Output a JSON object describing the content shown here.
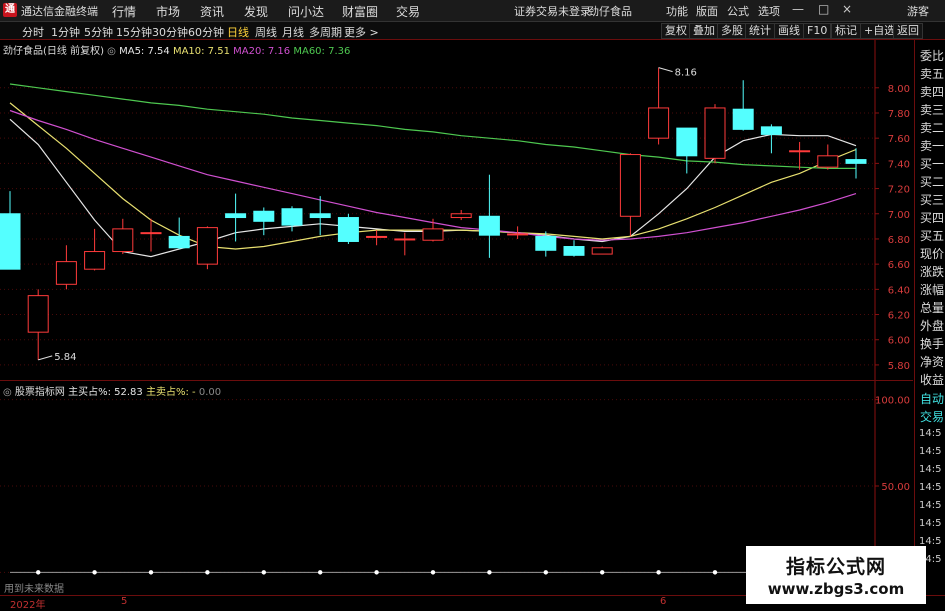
{
  "app": {
    "title": "通达信金融终端",
    "logo_text": "通"
  },
  "menu": [
    "行情",
    "市场",
    "资讯",
    "发现",
    "问小达",
    "财富圈",
    "交易"
  ],
  "notice": {
    "login": "证券交易未登录",
    "stock": "劲仔食品"
  },
  "right_menu": [
    "功能",
    "版面",
    "公式",
    "选项"
  ],
  "guest": "游客",
  "window_controls": {
    "minimize": "—",
    "maximize": "□",
    "close": "×"
  },
  "periods": [
    "分时",
    "1分钟",
    "5分钟",
    "15分钟",
    "30分钟",
    "60分钟",
    "日线",
    "周线",
    "月线",
    "多周期",
    "更多 >"
  ],
  "active_period": "日线",
  "toolbar": [
    "复权",
    "叠加",
    "多股",
    "统计",
    "画线",
    "F10",
    "标记",
    "+自选",
    "返回"
  ],
  "main_legend": {
    "stock": "劲仔食品(日线 前复权)",
    "ma5": "MA5: 7.54",
    "ma10": "MA10: 7.51",
    "ma20": "MA20: 7.16",
    "ma60": "MA60: 7.36"
  },
  "sub_legend": {
    "name": "股票指标网",
    "buy": "主买占%: 52.83",
    "sell_label": "主卖占%: -",
    "sell_value": "0.00"
  },
  "right_panel": [
    "委比",
    "卖五",
    "卖四",
    "卖三",
    "卖二",
    "卖一",
    "买一",
    "买二",
    "买三",
    "买四",
    "买五",
    "现价",
    "涨跌",
    "涨幅",
    "总量",
    "外盘",
    "换手",
    "净资",
    "收益",
    "自动",
    "交易"
  ],
  "tick_times": [
    "14:5",
    "14:5",
    "14:5",
    "14:5",
    "14:5",
    "14:5",
    "14:5",
    "14:5"
  ],
  "bottom_dates": [
    "2022年",
    "5",
    "6"
  ],
  "bottom_hint": "用到未来数据",
  "watermark": {
    "line1": "指标公式网",
    "line2": "www.zbgs3.com"
  },
  "colors": {
    "up": "#ff3b3b",
    "down": "#54ffff",
    "ma5": "#e6e6e6",
    "ma10": "#e8e070",
    "ma20": "#d050d0",
    "ma60": "#4ec850",
    "grid": "#4a0a0a",
    "axis": "#8b1010"
  },
  "chart_data": [
    {
      "type": "candlestick",
      "title": "劲仔食品(日线 前复权)",
      "y_ticks": [
        5.8,
        6.0,
        6.2,
        6.4,
        6.6,
        6.8,
        7.0,
        7.2,
        7.4,
        7.6,
        7.8,
        8.0
      ],
      "ylim": [
        5.72,
        8.3
      ],
      "annotations": [
        {
          "label": "8.16",
          "value": 8.16,
          "index": 23
        },
        {
          "label": "5.84",
          "value": 5.84,
          "index": 1
        }
      ],
      "candles": [
        {
          "o": 7.0,
          "c": 6.56,
          "h": 7.18,
          "l": 6.56
        },
        {
          "o": 6.06,
          "c": 6.35,
          "h": 6.4,
          "l": 5.84
        },
        {
          "o": 6.44,
          "c": 6.62,
          "h": 6.75,
          "l": 6.4
        },
        {
          "o": 6.56,
          "c": 6.7,
          "h": 6.88,
          "l": 6.55
        },
        {
          "o": 6.7,
          "c": 6.88,
          "h": 6.96,
          "l": 6.68
        },
        {
          "o": 6.85,
          "c": 6.85,
          "h": 6.96,
          "l": 6.7
        },
        {
          "o": 6.82,
          "c": 6.73,
          "h": 6.97,
          "l": 6.72
        },
        {
          "o": 6.6,
          "c": 6.89,
          "h": 6.9,
          "l": 6.56
        },
        {
          "o": 7.0,
          "c": 6.97,
          "h": 7.16,
          "l": 6.78
        },
        {
          "o": 7.02,
          "c": 6.94,
          "h": 7.05,
          "l": 6.83
        },
        {
          "o": 7.04,
          "c": 6.91,
          "h": 7.06,
          "l": 6.86
        },
        {
          "o": 7.0,
          "c": 6.97,
          "h": 7.14,
          "l": 6.83
        },
        {
          "o": 6.97,
          "c": 6.78,
          "h": 7.0,
          "l": 6.76
        },
        {
          "o": 6.82,
          "c": 6.82,
          "h": 6.87,
          "l": 6.75
        },
        {
          "o": 6.8,
          "c": 6.8,
          "h": 6.85,
          "l": 6.67
        },
        {
          "o": 6.79,
          "c": 6.88,
          "h": 6.96,
          "l": 6.78
        },
        {
          "o": 6.97,
          "c": 7.0,
          "h": 7.03,
          "l": 6.95
        },
        {
          "o": 6.98,
          "c": 6.83,
          "h": 7.31,
          "l": 6.65
        },
        {
          "o": 6.84,
          "c": 6.84,
          "h": 6.9,
          "l": 6.8
        },
        {
          "o": 6.82,
          "c": 6.71,
          "h": 6.86,
          "l": 6.66
        },
        {
          "o": 6.74,
          "c": 6.67,
          "h": 6.79,
          "l": 6.66
        },
        {
          "o": 6.68,
          "c": 6.73,
          "h": 6.74,
          "l": 6.68
        },
        {
          "o": 6.98,
          "c": 7.47,
          "h": 7.48,
          "l": 6.82
        },
        {
          "o": 7.6,
          "c": 7.84,
          "h": 8.16,
          "l": 7.55
        },
        {
          "o": 7.68,
          "c": 7.46,
          "h": 7.68,
          "l": 7.32
        },
        {
          "o": 7.44,
          "c": 7.84,
          "h": 7.87,
          "l": 7.4
        },
        {
          "o": 7.83,
          "c": 7.67,
          "h": 8.06,
          "l": 7.66
        },
        {
          "o": 7.69,
          "c": 7.63,
          "h": 7.71,
          "l": 7.48
        },
        {
          "o": 7.5,
          "c": 7.5,
          "h": 7.57,
          "l": 7.35
        },
        {
          "o": 7.37,
          "c": 7.46,
          "h": 7.55,
          "l": 7.35
        },
        {
          "o": 7.43,
          "c": 7.4,
          "h": 7.52,
          "l": 7.28
        }
      ],
      "series": [
        {
          "name": "MA5",
          "values": [
            7.75,
            7.55,
            7.25,
            6.95,
            6.7,
            6.66,
            6.72,
            6.78,
            6.85,
            6.88,
            6.9,
            6.92,
            6.9,
            6.88,
            6.86,
            6.86,
            6.87,
            6.86,
            6.85,
            6.83,
            6.8,
            6.78,
            6.82,
            7.0,
            7.2,
            7.45,
            7.58,
            7.63,
            7.62,
            7.62,
            7.54
          ]
        },
        {
          "name": "MA10",
          "values": [
            7.88,
            7.7,
            7.52,
            7.32,
            7.12,
            6.95,
            6.83,
            6.74,
            6.72,
            6.74,
            6.78,
            6.82,
            6.85,
            6.87,
            6.87,
            6.87,
            6.87,
            6.86,
            6.85,
            6.84,
            6.82,
            6.8,
            6.82,
            6.88,
            6.96,
            7.05,
            7.15,
            7.25,
            7.32,
            7.42,
            7.51
          ]
        },
        {
          "name": "MA20",
          "values": [
            7.82,
            7.74,
            7.67,
            7.59,
            7.52,
            7.45,
            7.38,
            7.31,
            7.26,
            7.21,
            7.16,
            7.11,
            7.06,
            7.01,
            6.97,
            6.93,
            6.89,
            6.87,
            6.85,
            6.82,
            6.8,
            6.79,
            6.8,
            6.82,
            6.85,
            6.89,
            6.93,
            6.98,
            7.03,
            7.09,
            7.16
          ]
        },
        {
          "name": "MA60",
          "values": [
            8.03,
            8.0,
            7.97,
            7.94,
            7.91,
            7.88,
            7.86,
            7.83,
            7.81,
            7.79,
            7.76,
            7.74,
            7.72,
            7.7,
            7.67,
            7.65,
            7.62,
            7.6,
            7.58,
            7.55,
            7.53,
            7.5,
            7.47,
            7.45,
            7.42,
            7.41,
            7.39,
            7.38,
            7.37,
            7.36,
            7.36
          ]
        }
      ]
    },
    {
      "type": "line",
      "title": "股票指标网",
      "y_ticks": [
        0.0,
        50.0,
        100.0
      ],
      "ylim": [
        -5,
        105
      ],
      "series": [
        {
          "name": "主卖占%",
          "values": [
            0,
            0,
            0,
            0,
            0,
            0,
            0,
            0,
            0,
            0,
            0,
            0,
            0,
            0,
            0,
            0,
            0,
            0,
            0,
            0,
            0,
            0,
            0,
            0,
            0,
            0,
            0,
            0,
            0,
            0,
            0
          ],
          "dots_every": 2
        }
      ]
    }
  ]
}
